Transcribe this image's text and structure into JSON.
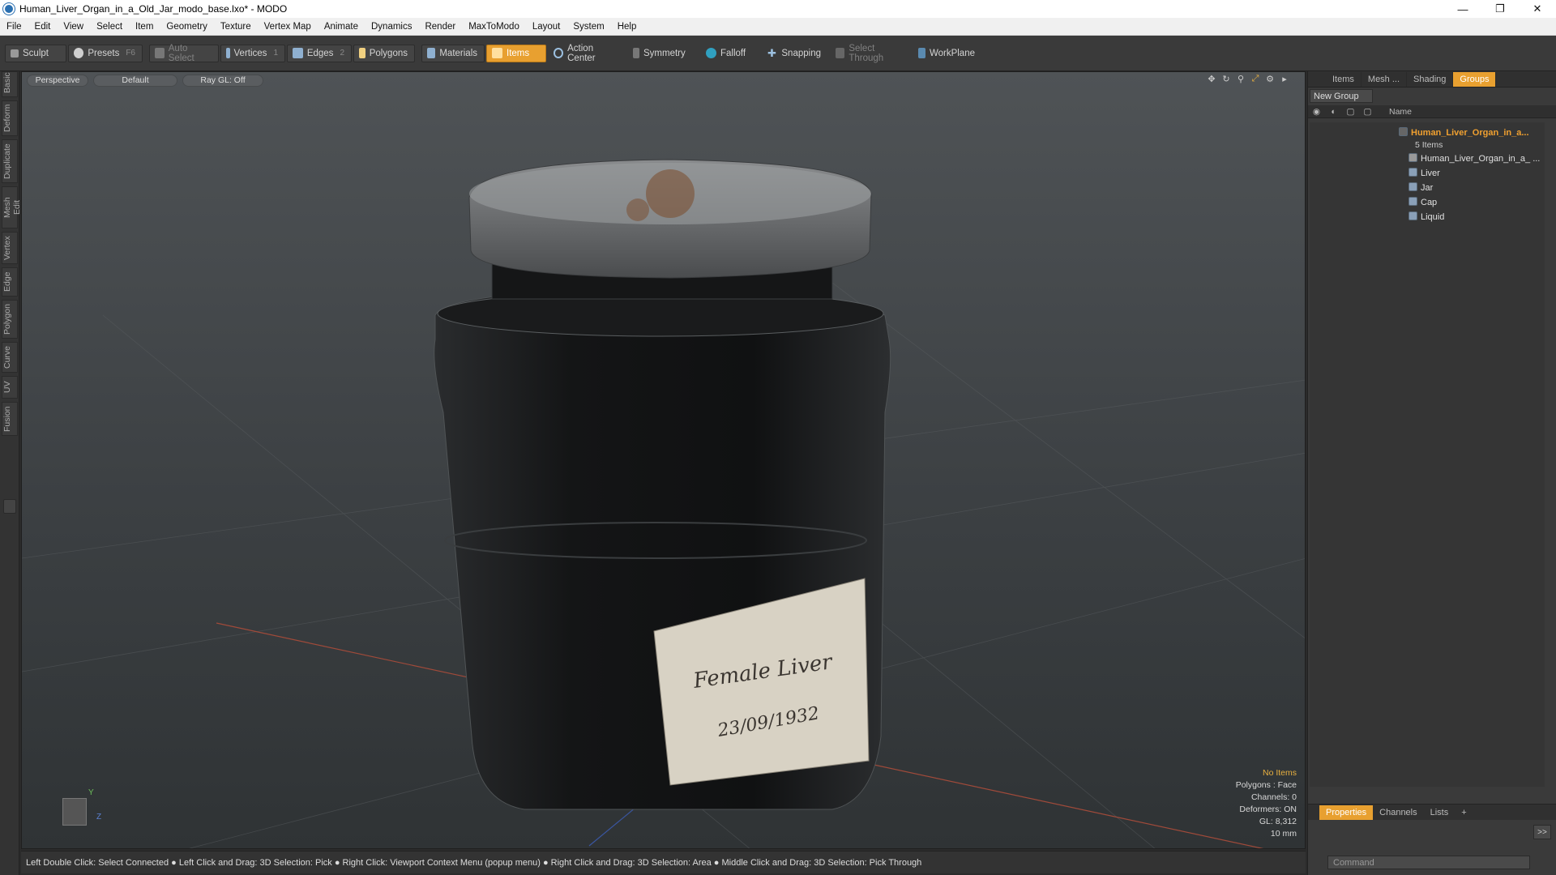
{
  "window": {
    "title": "Human_Liver_Organ_in_a_Old_Jar_modo_base.lxo* - MODO",
    "minimize": "—",
    "maximize": "❐",
    "close": "✕"
  },
  "menu": [
    "File",
    "Edit",
    "View",
    "Select",
    "Item",
    "Geometry",
    "Texture",
    "Vertex Map",
    "Animate",
    "Dynamics",
    "Render",
    "MaxToModo",
    "Layout",
    "System",
    "Help"
  ],
  "toolbar": {
    "sculpt": "Sculpt",
    "presets": "Presets",
    "presets_key": "F6",
    "auto_select": "Auto Select",
    "vertices": "Vertices",
    "vertices_key": "1",
    "edges": "Edges",
    "edges_key": "2",
    "polygons": "Polygons",
    "materials": "Materials",
    "items": "Items",
    "action_center": "Action Center",
    "symmetry": "Symmetry",
    "falloff": "Falloff",
    "snapping": "Snapping",
    "select_through": "Select Through",
    "workplane": "WorkPlane"
  },
  "left_tabs": [
    "Basic",
    "Deform",
    "Duplicate",
    "Mesh Edit",
    "Vertex",
    "Edge",
    "Polygon",
    "Curve",
    "UV",
    "Fusion"
  ],
  "viewport": {
    "view": "Perspective",
    "shading": "Default",
    "raygl": "Ray GL: Off",
    "label_text1": "Female Liver",
    "label_text2": "23/09/1932",
    "stats": {
      "no_items": "No Items",
      "polygons": "Polygons : Face",
      "channels": "Channels: 0",
      "deformers": "Deformers: ON",
      "gl": "GL: 8,312",
      "scale": "10 mm"
    },
    "axis_y": "Y",
    "axis_z": "Z"
  },
  "statusbar": "Left Double Click: Select Connected ● Left Click and Drag: 3D Selection: Pick ● Right Click: Viewport Context Menu (popup menu) ● Right Click and Drag: 3D Selection: Area ● Middle Click and Drag: 3D Selection: Pick Through",
  "right_panel": {
    "tabs": [
      "Items",
      "Mesh ...",
      "Shading",
      "Groups"
    ],
    "new_group": "New Group",
    "name_col": "Name",
    "group_name": "Human_Liver_Organ_in_a...",
    "group_count": "5 Items",
    "children": [
      "Human_Liver_Organ_in_a_ ...",
      "Liver",
      "Jar",
      "Cap",
      "Liquid"
    ],
    "bottom_tabs": [
      "Properties",
      "Channels",
      "Lists",
      "+"
    ],
    "command_placeholder": "Command",
    "expand": ">>"
  },
  "colors": {
    "accent": "#e8a030",
    "viewport_bg": "#45494c",
    "panel_bg": "#3a3a3a"
  }
}
